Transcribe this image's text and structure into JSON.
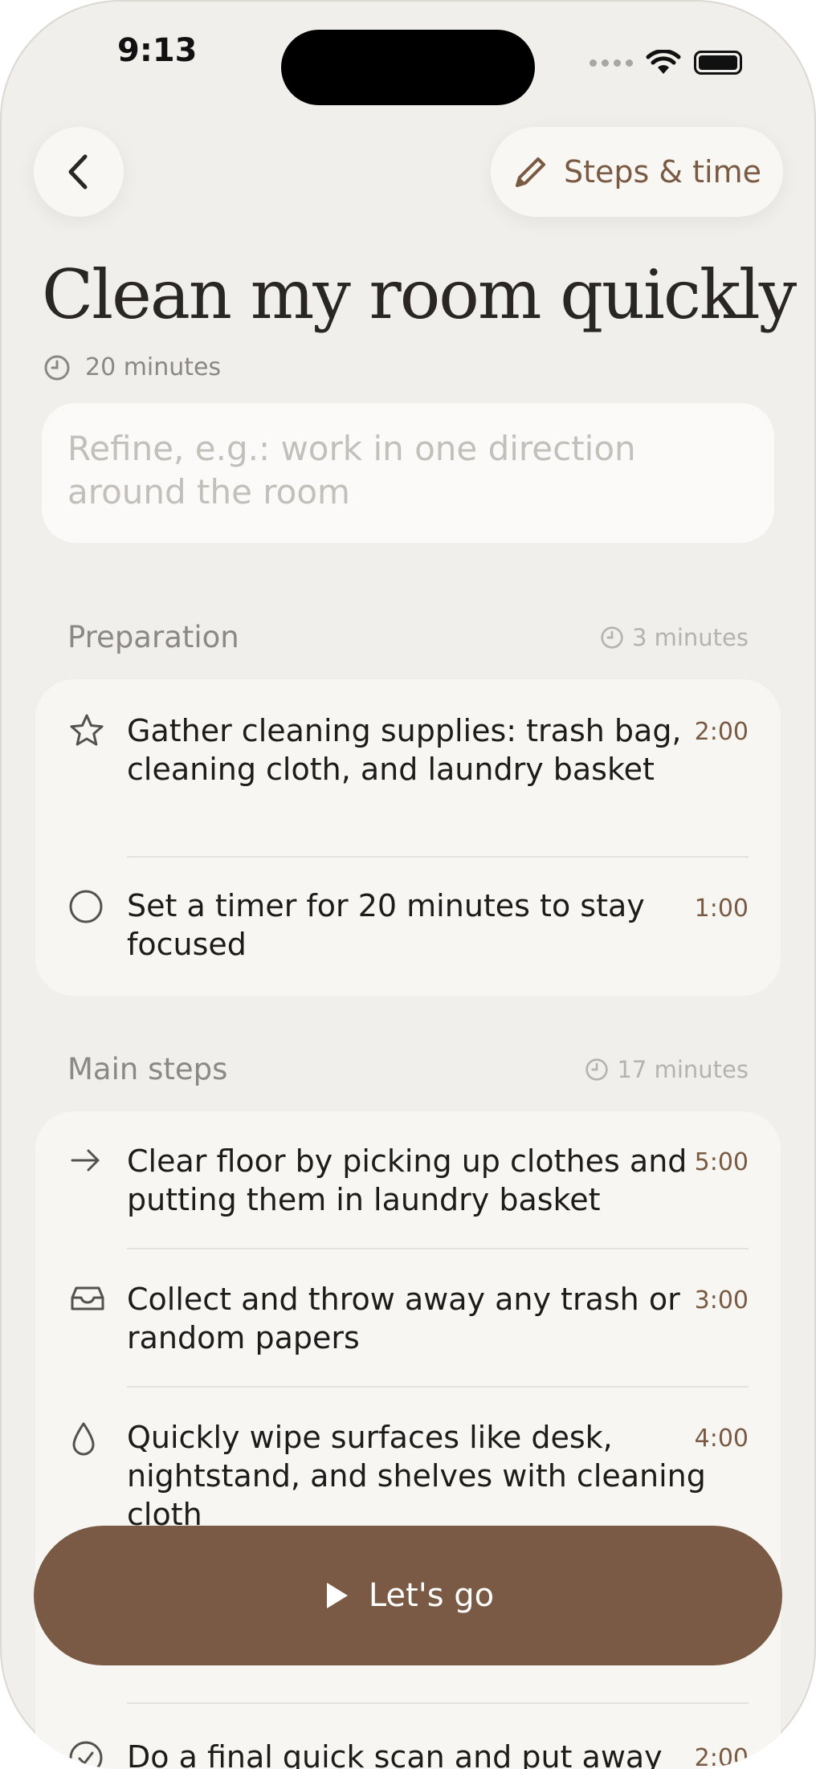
{
  "status_bar": {
    "time": "9:13"
  },
  "header": {
    "back_icon": "chevron-left-icon",
    "steps_button_label": "Steps & time",
    "steps_button_icon": "pencil-icon"
  },
  "task": {
    "title": "Clean my room quickly",
    "duration": "20 minutes"
  },
  "refine": {
    "placeholder": "Refine, e.g.: work in one direction around the room",
    "value": ""
  },
  "sections": [
    {
      "title": "Preparation",
      "duration": "3 minutes",
      "steps": [
        {
          "icon": "star-icon",
          "text": "Gather cleaning supplies: trash bag, cleaning cloth, and laundry basket",
          "time": "2:00"
        },
        {
          "icon": "circle-icon",
          "text": "Set a timer for 20 minutes to stay focused",
          "time": "1:00"
        }
      ]
    },
    {
      "title": "Main steps",
      "duration": "17 minutes",
      "steps": [
        {
          "icon": "arrow-right-icon",
          "text": "Clear floor by picking up clothes and putting them in laundry basket",
          "time": "5:00"
        },
        {
          "icon": "tray-icon",
          "text": "Collect and throw away any trash or random papers",
          "time": "3:00"
        },
        {
          "icon": "drop-icon",
          "text": "Quickly wipe surfaces like desk, nightstand, and shelves with cleaning cloth",
          "time": "4:00"
        },
        {
          "icon": "check-circle-icon",
          "text": "Do a final quick scan and put away",
          "time": "2:00"
        }
      ]
    }
  ],
  "primary_action": {
    "label": "Let's go",
    "icon": "play-icon"
  },
  "colors": {
    "accent": "#7a5a44",
    "background": "#f1efeb",
    "card": "#f7f6f3"
  }
}
